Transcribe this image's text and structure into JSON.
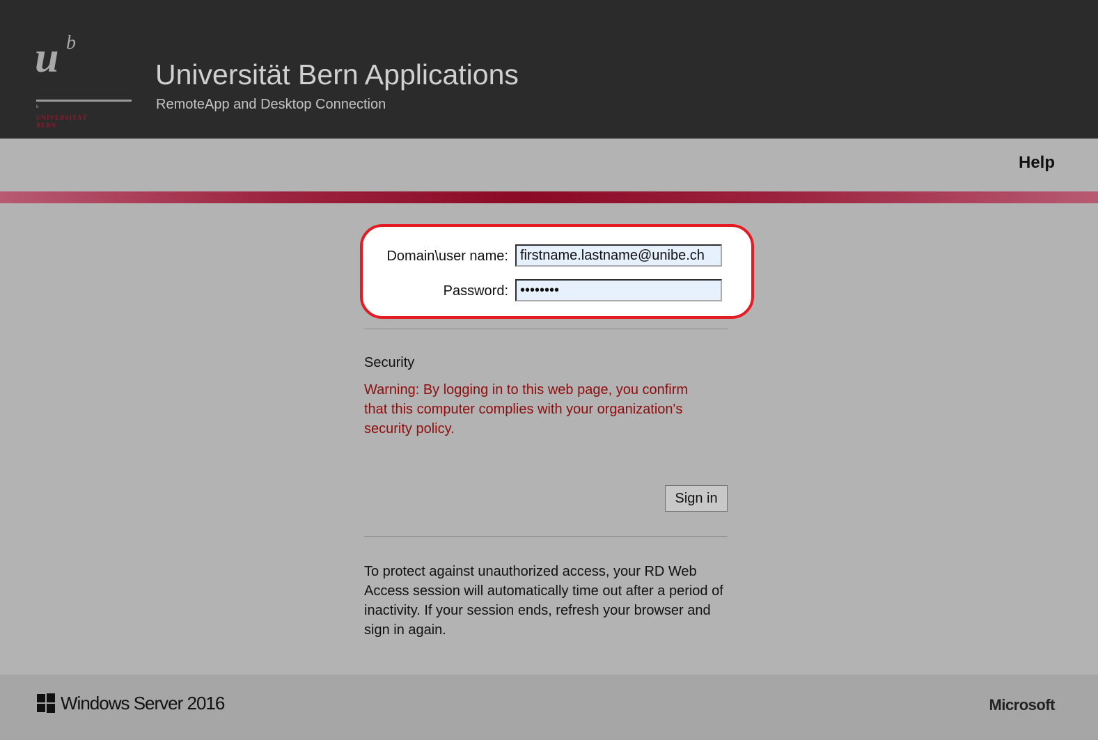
{
  "header": {
    "logo": {
      "letter_u": "u",
      "letter_b": "b",
      "text_line1": "UNIVERSITÄT",
      "text_line2": "BERN"
    },
    "title": "Universität Bern Applications",
    "subtitle": "RemoteApp and Desktop Connection"
  },
  "toolbar": {
    "help_label": "Help"
  },
  "accent_color": "#8b0a25",
  "login": {
    "username_label": "Domain\\user name:",
    "username_value": "firstname.lastname@unibe.ch",
    "password_label": "Password:",
    "password_value": "12345678",
    "highlight_color": "#e41b23"
  },
  "security": {
    "heading": "Security",
    "warning": "Warning: By logging in to this web page, you confirm that this computer complies with your organization's security policy.",
    "warning_color": "#8e0d0d"
  },
  "actions": {
    "sign_in_label": "Sign in"
  },
  "timeout_notice": "To protect against unauthorized access, your RD Web Access session will automatically time out after a period of inactivity. If your session ends, refresh your browser and sign in again.",
  "footer": {
    "product_icon": "windows-logo-icon",
    "product_name": "Windows Server 2016",
    "brand": "Microsoft"
  }
}
